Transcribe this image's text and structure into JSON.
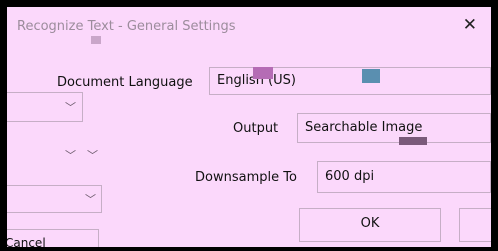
{
  "window": {
    "title": "Recognize Text - General Settings",
    "close_glyph": "✕"
  },
  "fields": {
    "document_language": {
      "label": "Document Language",
      "value": "English (US)"
    },
    "output": {
      "label": "Output",
      "value": "Searchable Image"
    },
    "downsample": {
      "label": "Downsample To",
      "value": "600 dpi"
    }
  },
  "buttons": {
    "ok": "OK",
    "cancel": "Cancel"
  },
  "icons": {
    "chevron": "chevron-down-icon"
  }
}
